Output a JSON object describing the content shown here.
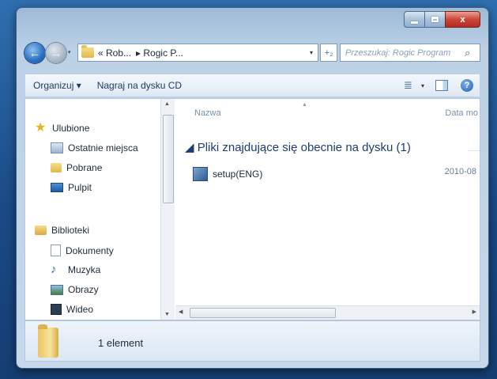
{
  "window": {
    "caption": {
      "minimize": "",
      "maximize": "",
      "close": "x"
    }
  },
  "nav": {
    "back_icon": "back-arrow-icon",
    "forward_icon": "forward-arrow-icon",
    "breadcrumb": [
      "« Rob...",
      "▸ Rogic P..."
    ],
    "address_dropdown": "▾",
    "refresh": "+₂",
    "search_placeholder": "Przeszukaj: Rogic Program",
    "search_icon": "⌕"
  },
  "toolbar": {
    "organize": "Organizuj ▾",
    "burn": "Nagraj na dysku CD",
    "view_icon": "≣",
    "view_drop": "▾",
    "help": "?"
  },
  "sidebar": {
    "favorites_label": "Ulubione",
    "favorites_items": [
      "Ostatnie miejsca",
      "Pobrane",
      "Pulpit"
    ],
    "libraries_label": "Biblioteki",
    "libraries_items": [
      "Dokumenty",
      "Muzyka",
      "Obrazy",
      "Wideo"
    ]
  },
  "files": {
    "col_name": "Nazwa",
    "col_date": "Data mo",
    "group_label": "◢ Pliki znajdujące się obecnie na dysku (1)",
    "rows": [
      {
        "name": "setup(ENG)",
        "date": "2010-08"
      }
    ]
  },
  "status": {
    "item_count": "1 element"
  },
  "colors": {
    "accent": "#1f3c74",
    "close_red": "#c9473a"
  }
}
